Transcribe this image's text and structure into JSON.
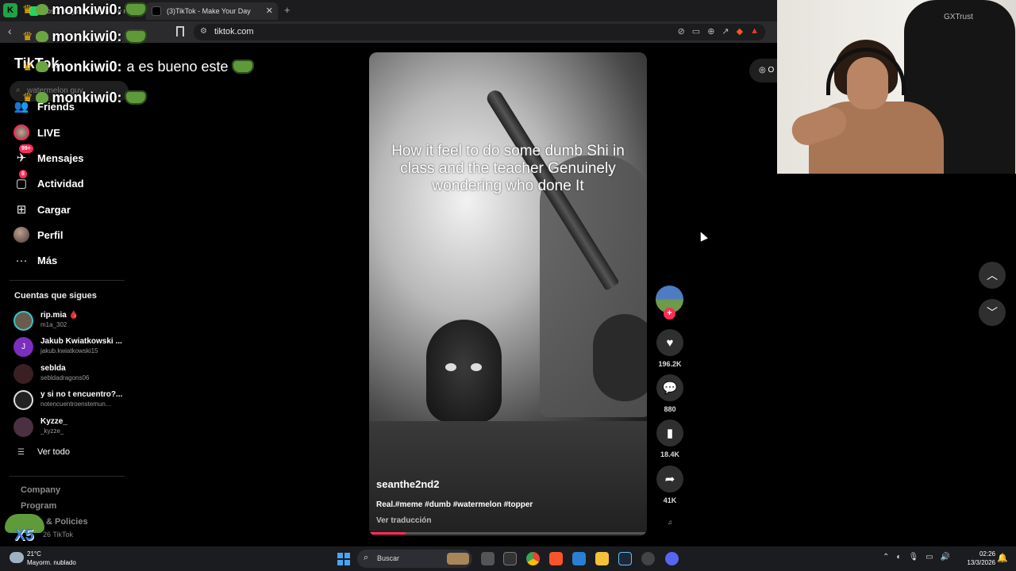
{
  "browser": {
    "tabs": [
      {
        "label": "rosbi playlist - playlist by rosbi | Spo...",
        "active": false
      },
      {
        "label": "(3)TikTok - Make Your Day",
        "active": true
      }
    ],
    "url": "tiktok.com"
  },
  "sidebar": {
    "logo": "TikTok",
    "search_placeholder": "watermelon guy",
    "nav": [
      {
        "label": "Friends",
        "icon": "friends-icon"
      },
      {
        "label": "LIVE",
        "icon": "live-icon"
      },
      {
        "label": "Mensajes",
        "icon": "messages-icon",
        "badge": "99+"
      },
      {
        "label": "Actividad",
        "icon": "activity-icon",
        "badge": "8"
      },
      {
        "label": "Cargar",
        "icon": "upload-icon"
      },
      {
        "label": "Perfil",
        "icon": "profile-icon"
      },
      {
        "label": "Más",
        "icon": "more-icon"
      }
    ],
    "following_title": "Cuentas que sigues",
    "following": [
      {
        "name": "rip.mia 🩸",
        "user": "m1a_302",
        "avatar_color": "#6b5a4e"
      },
      {
        "name": "Jakub Kwiatkowski ...",
        "user": "jakub.kwiatkowski15",
        "avatar_color": "#7b2fbe",
        "initial": "J"
      },
      {
        "name": "seblda",
        "user": "sebldadragons06",
        "avatar_color": "#3a2020"
      },
      {
        "name": "y si no t encuentro?...",
        "user": "notencuentroenstemun...",
        "avatar_color": "#222"
      },
      {
        "name": "Kyzze_",
        "user": "_kyzze_",
        "avatar_color": "#4a3040"
      }
    ],
    "see_all": "Ver todo",
    "footer": [
      "Company",
      "Program",
      "& Policies"
    ],
    "copyright": "26 TikTok"
  },
  "chat": [
    {
      "user": "monkiwi0:",
      "message": ""
    },
    {
      "user": "monkiwi0:",
      "message": ""
    },
    {
      "user": "monkiwi0:",
      "message": "a es bueno este"
    },
    {
      "user": "monkiwi0:",
      "message": ""
    }
  ],
  "video": {
    "caption": "How it feel to do some dumb Shi in class and the teacher Genuinely wondering who done It",
    "author": "seanthe2nd2",
    "description": "Real.#meme #dumb #watermelon #topper",
    "translate": "Ver traducción",
    "progress": 0.13
  },
  "actions": {
    "likes": "196.2K",
    "comments": "880",
    "saves": "18.4K",
    "shares": "41K"
  },
  "webcam": {
    "brand": "GXTrust"
  },
  "taskbar": {
    "weather_temp": "21°C",
    "weather_desc": "Mayorm. nublado",
    "search_label": "Buscar",
    "time": "02:26",
    "date": "13/3/2026"
  },
  "colors": {
    "accent": "#fe2c55",
    "background": "#000000"
  }
}
